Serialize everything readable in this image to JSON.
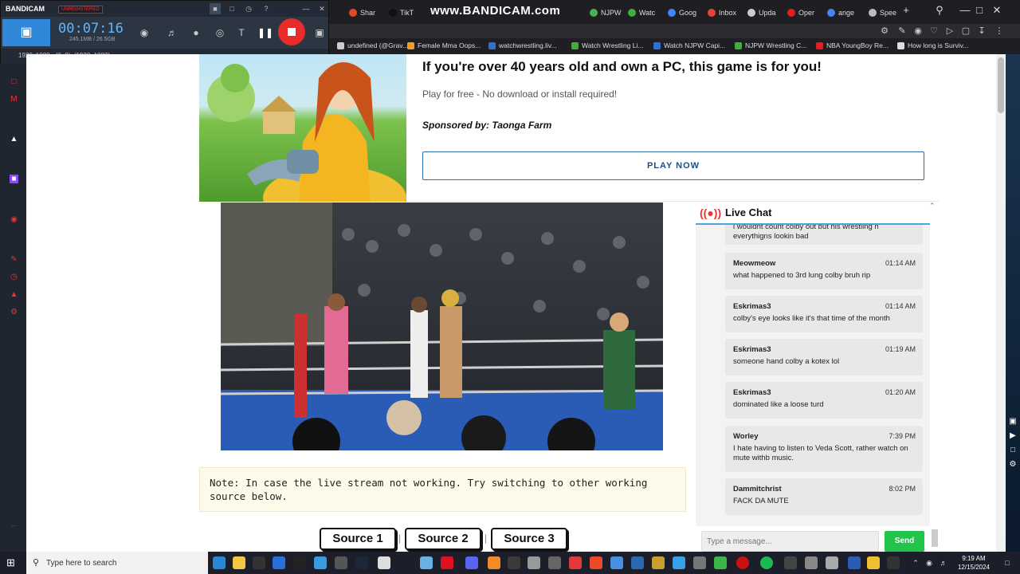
{
  "recorder": {
    "logo": "BANDICAM",
    "unregistered": "UNREGISTERED",
    "elapsed": "00:07:16",
    "file_size": "245.1MB / 26.5GB",
    "resolution": "1920x1080 - (0, 0), (1920, 1080)",
    "watermark": "www.BANDICAM.com"
  },
  "tabs": [
    {
      "label": "Shar",
      "color": "#e04a2a"
    },
    {
      "label": "TikT",
      "color": "#111111"
    },
    {
      "label": "NJPW",
      "color": "#4caf50"
    },
    {
      "label": "Watc",
      "color": "#3fae3f"
    },
    {
      "label": "Goog",
      "color": "#4285f4"
    },
    {
      "label": "Inbox",
      "color": "#ea4335"
    },
    {
      "label": "Upda",
      "color": "#cccccc"
    },
    {
      "label": "Oper",
      "color": "#e02020"
    },
    {
      "label": "ange",
      "color": "#4285f4"
    },
    {
      "label": "Spee",
      "color": "#bbbbbb"
    }
  ],
  "bookmarks": [
    {
      "label": "undefined (@Grav...",
      "color": "#cccccc"
    },
    {
      "label": "Female Mma Oops...",
      "color": "#f0a020"
    },
    {
      "label": "watchwrestling.liv...",
      "color": "#2f6fd6"
    },
    {
      "label": "Watch Wrestling Li...",
      "color": "#3fae3f"
    },
    {
      "label": "Watch NJPW Capi...",
      "color": "#2f6fd6"
    },
    {
      "label": "NJPW Wrestling C...",
      "color": "#3fae3f"
    },
    {
      "label": "NBA YoungBoy Re...",
      "color": "#e02020"
    },
    {
      "label": "How long is Surviv...",
      "color": "#dddddd"
    }
  ],
  "ad": {
    "title": "If you're over 40 years old and own a PC, this game is for you!",
    "subtitle": "Play for free - No download or install required!",
    "sponsor": "Sponsored by: Taonga Farm",
    "cta": "PLAY NOW"
  },
  "note": "Note: In case the live stream not working. Try switching to other working source below.",
  "sources": [
    "Source 1",
    "Source 2",
    "Source 3"
  ],
  "chat": {
    "title": "Live Chat",
    "partial_top": "i wouldnt count colby out but his wrestling n everythigns lookin bad",
    "messages": [
      {
        "user": "Meowmeow",
        "time": "01:14 AM",
        "text": "what happened to 3rd lung colby bruh rip"
      },
      {
        "user": "Eskrimas3",
        "time": "01:14 AM",
        "text": "colby's eye looks like it's that time of the month"
      },
      {
        "user": "Eskrimas3",
        "time": "01:19 AM",
        "text": "someone hand colby a kotex lol"
      },
      {
        "user": "Eskrimas3",
        "time": "01:20 AM",
        "text": "dominated like a loose turd"
      },
      {
        "user": "Worley",
        "time": "7:39 PM",
        "text": "I hate having to listen to Veda Scott, rather watch on mute withb music."
      },
      {
        "user": "Dammitchrist",
        "time": "8:02 PM",
        "text": "FACK DA MUTE"
      }
    ],
    "input_placeholder": "Type a message...",
    "send": "Send"
  },
  "taskbar": {
    "search_placeholder": "Type here to search",
    "time": "9:19 AM",
    "date": "12/15/2024"
  }
}
